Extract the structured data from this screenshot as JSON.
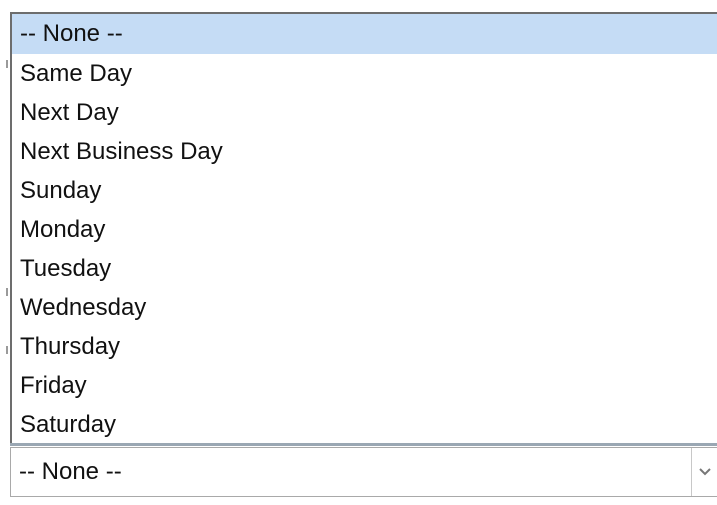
{
  "dropdown": {
    "options": [
      {
        "label": "-- None --",
        "selected": true
      },
      {
        "label": "Same Day",
        "selected": false
      },
      {
        "label": "Next Day",
        "selected": false
      },
      {
        "label": "Next Business Day",
        "selected": false
      },
      {
        "label": "Sunday",
        "selected": false
      },
      {
        "label": "Monday",
        "selected": false
      },
      {
        "label": "Tuesday",
        "selected": false
      },
      {
        "label": "Wednesday",
        "selected": false
      },
      {
        "label": "Thursday",
        "selected": false
      },
      {
        "label": "Friday",
        "selected": false
      },
      {
        "label": "Saturday",
        "selected": false
      }
    ],
    "selected_value": "-- None --",
    "arrow_icon": "chevron-down-icon",
    "highlight_color": "#c5dcf5"
  }
}
